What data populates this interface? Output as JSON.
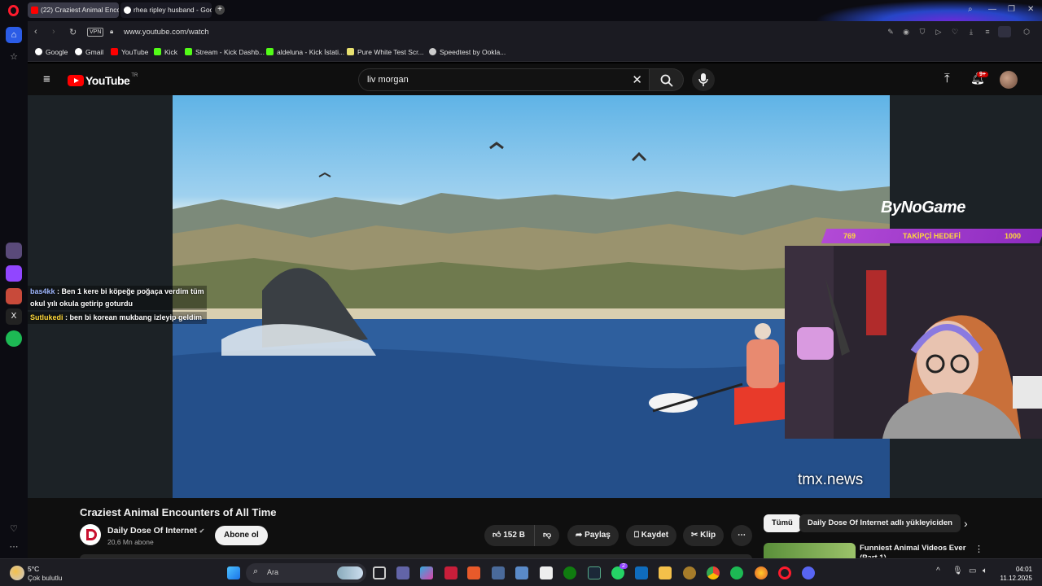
{
  "browser": {
    "tabs": [
      {
        "title": "(22) Craziest Animal Enco",
        "active": true
      },
      {
        "title": "rhea ripley husband - Goo",
        "active": false
      }
    ],
    "address": {
      "vpn_badge": "VPN",
      "url": "www.youtube.com/watch"
    },
    "bookmarks": [
      {
        "label": "Google",
        "color": "#ffffff"
      },
      {
        "label": "Gmail",
        "color": "#ffffff"
      },
      {
        "label": "YouTube",
        "color": "#ff0000"
      },
      {
        "label": "Kick",
        "color": "#53fc18"
      },
      {
        "label": "Stream - Kick Dashb...",
        "color": "#53fc18"
      },
      {
        "label": "aldeluna - Kick İstati...",
        "color": "#53fc18"
      },
      {
        "label": "Pure White Test Scr...",
        "color": "#e8e070"
      },
      {
        "label": "Speedtest by Ookla...",
        "color": "#cccccc"
      }
    ]
  },
  "youtube": {
    "logo_text": "YouTube",
    "region": "TR",
    "search_query": "liv morgan",
    "notification_count": "9+",
    "video": {
      "title": "Craziest Animal Encounters of All Time",
      "channel": "Daily Dose Of Internet",
      "subscribers": "20,6 Mn abone",
      "subscribe_label": "Abone ol",
      "likes": "152 B",
      "share_label": "Paylaş",
      "save_label": "Kaydet",
      "clip_label": "Klip",
      "watermark": "tmx.news"
    },
    "overlay": {
      "chat": [
        {
          "user": "bas4kk",
          "message": "Ben 1 kere bi köpeğe poğaça verdim tüm okul yılı okula getirip goturdu"
        },
        {
          "user": "Sutlukedi",
          "message": "ben bi korean mukbang izleyip geldim"
        }
      ],
      "brand": "ByNoGame",
      "follow_goal": {
        "current": "769",
        "label": "TAKİPÇİ HEDEFİ",
        "target": "1000"
      }
    },
    "filters": {
      "chips": [
        "Tümü",
        "Daily Dose Of Internet adlı yükleyiciden"
      ]
    },
    "recommendation": {
      "title": "Funniest Animal Videos Ever (Part 1)"
    }
  },
  "taskbar": {
    "weather_temp": "5°C",
    "weather_desc": "Çok bulutlu",
    "search_placeholder": "Ara",
    "time": "04:01",
    "date": "11.12.2025",
    "whatsapp_badge": "2"
  },
  "colors": {
    "youtube_red": "#ff0000",
    "accent_purple": "#b24ad6",
    "goal_yellow": "#ffd93a"
  }
}
